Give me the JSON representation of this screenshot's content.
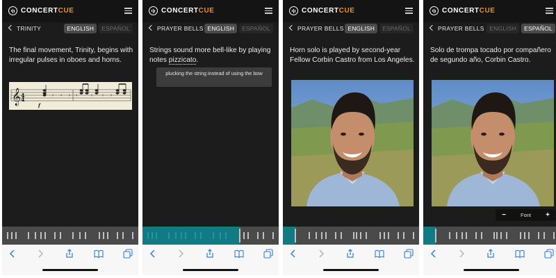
{
  "app": {
    "logo_part1": "CONCERT",
    "logo_part2": "CUE",
    "accent_color": "#e8912a",
    "timeline_color": "#117a82"
  },
  "lang": {
    "english": "ENGLISH",
    "spanish": "ESPAÑOL"
  },
  "screens": [
    {
      "piece_title": "TRINITY",
      "active_lang": "english",
      "text": "The final movement, Trinity, begins with irregular pulses in oboes and horns.",
      "image": "music-score-excerpt",
      "timeline_progress": 0
    },
    {
      "piece_title": "PRAYER BELLS",
      "active_lang": "english",
      "text_before": "Strings sound more bell-like by playing notes ",
      "text_term": "pizzicato",
      "text_after": ".",
      "tooltip": "plucking the string instead of using the bow",
      "timeline_progress": 0.7
    },
    {
      "piece_title": "PRAYER BELLS",
      "active_lang": "english",
      "text": "Horn solo is played by second-year Fellow Corbin Castro from Los Angeles.",
      "image": "portrait-photo",
      "timeline_progress": 0.09
    },
    {
      "piece_title": "PRAYER BELLS",
      "active_lang": "spanish",
      "text": "Solo de trompa tocado por compañero de segundo año, Corbin Castro.",
      "image": "portrait-photo",
      "font_control": {
        "minus": "−",
        "label": "Font",
        "plus": "+"
      },
      "timeline_progress": 0.09
    }
  ],
  "browser_icons": [
    "back-arrow-icon",
    "forward-arrow-icon",
    "share-icon",
    "bookmarks-icon",
    "tabs-icon"
  ]
}
